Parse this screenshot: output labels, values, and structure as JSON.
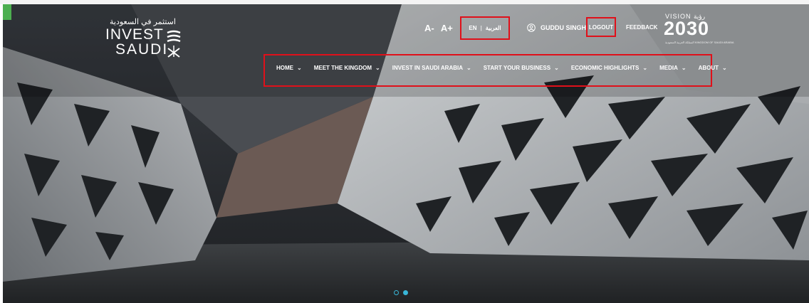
{
  "logo": {
    "arabic_text": "استثمر في السعودية",
    "line1": "INVEST",
    "line2": "SAUDI"
  },
  "utility": {
    "font_decrease": "A-",
    "font_increase": "A+",
    "lang_en": "EN",
    "lang_ar": "العربية",
    "user_name": "GUDDU SINGH",
    "logout": "LOGOUT",
    "feedback": "FEEDBACK"
  },
  "vision": {
    "top": "VISION رؤية",
    "year": "2030",
    "sub": "المملكة العربية السعودية KINGDOM OF SAUDI ARABIA"
  },
  "nav": {
    "items": [
      {
        "label": "HOME"
      },
      {
        "label": "MEET THE KINGDOM"
      },
      {
        "label": "INVEST IN SAUDI ARABIA"
      },
      {
        "label": "START YOUR BUSINESS"
      },
      {
        "label": "ECONOMIC HIGHLIGHTS"
      },
      {
        "label": "MEDIA"
      },
      {
        "label": "ABOUT"
      }
    ],
    "chevron": "⌄"
  },
  "carousel": {
    "current_slide": 2,
    "total_slides": 2
  },
  "colors": {
    "highlight_box": "#e0101a",
    "accent": "#39b6d8",
    "hero_dark": "#2a2d31"
  }
}
